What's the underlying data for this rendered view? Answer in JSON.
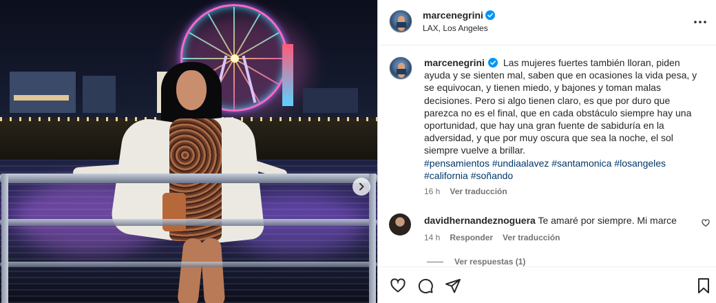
{
  "post": {
    "author": "marcenegrini",
    "location": "LAX, Los Angeles",
    "caption": "Las mujeres fuertes también lloran, piden ayuda y se sienten mal, saben que en ocasiones la vida pesa, y se equivocan, y tienen miedo, y bajones y toman malas decisiones. Pero si algo tienen claro, es que por duro que parezca no es el final, que en cada obstáculo siempre hay una oportunidad, que hay una gran fuente de sabiduría en la adversidad, y que por muy oscura que sea la noche, el sol siempre vuelve a brillar.",
    "hashtags": [
      "#pensamientos",
      "#undiaalavez",
      "#santamonica",
      "#losangeles",
      "#california",
      "#soñando"
    ],
    "time_ago": "16 h",
    "see_translation": "Ver traducción"
  },
  "comment": {
    "author": "davidhernandeznoguera",
    "text": "Te amaré por siempre. Mi marce",
    "time_ago": "14 h",
    "reply": "Responder",
    "see_translation": "Ver traducción",
    "view_replies": "Ver respuestas (1)"
  },
  "icons": {
    "verified": "verified-badge-icon",
    "more": "more-options-icon",
    "next": "chevron-right-icon",
    "like": "heart-icon",
    "comment": "comment-icon",
    "share": "share-icon",
    "save": "bookmark-icon"
  },
  "colors": {
    "verified": "#0095f6",
    "link": "#00376b",
    "muted": "#737373",
    "text": "#262626"
  }
}
